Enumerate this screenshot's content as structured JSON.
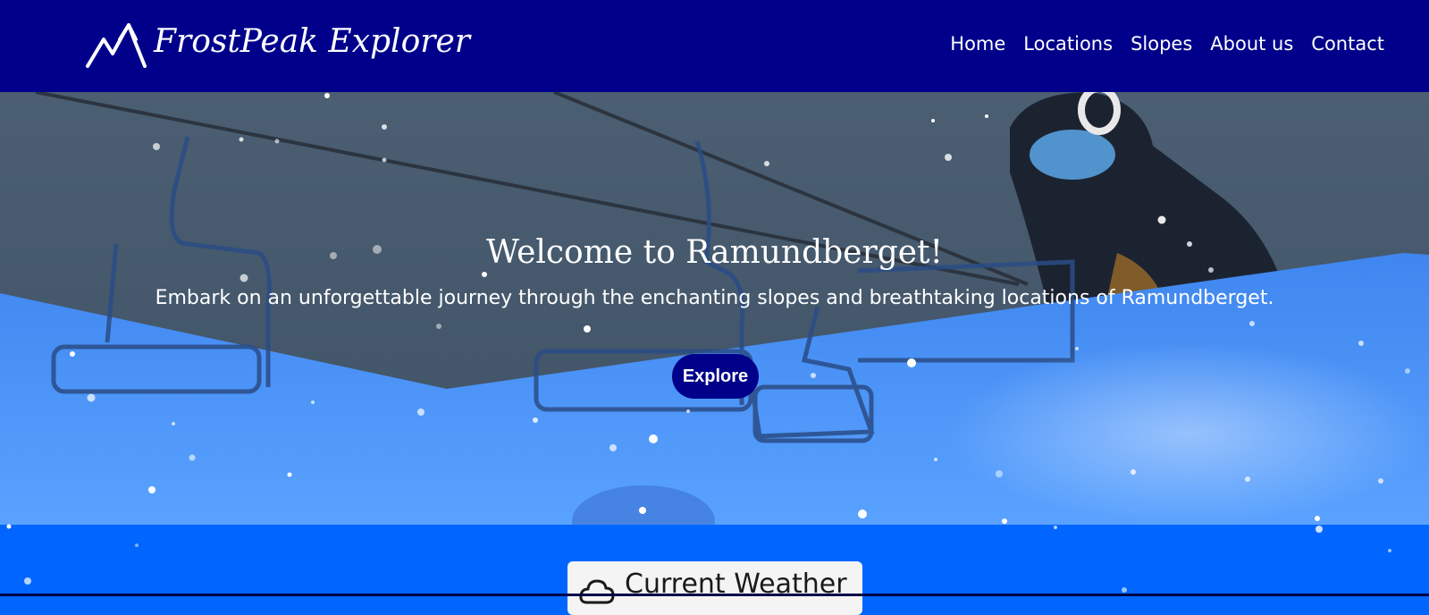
{
  "header": {
    "brand": "FrostPeak Explorer",
    "logo_icon": "mountain-icon",
    "nav": [
      {
        "label": "Home"
      },
      {
        "label": "Locations"
      },
      {
        "label": "Slopes"
      },
      {
        "label": "About us"
      },
      {
        "label": "Contact"
      }
    ]
  },
  "hero": {
    "title": "Welcome to Ramundberget!",
    "subtitle": "Embark on an unforgettable journey through the enchanting slopes and breathtaking locations of Ramundberget.",
    "button_label": "Explore"
  },
  "weather": {
    "title": "Current Weather",
    "icon": "cloud-icon"
  },
  "colors": {
    "header_bg": "#00008b",
    "accent_blue": "#0066ff",
    "hero_wave": "#4a90f0",
    "button_bg": "#00008b"
  }
}
